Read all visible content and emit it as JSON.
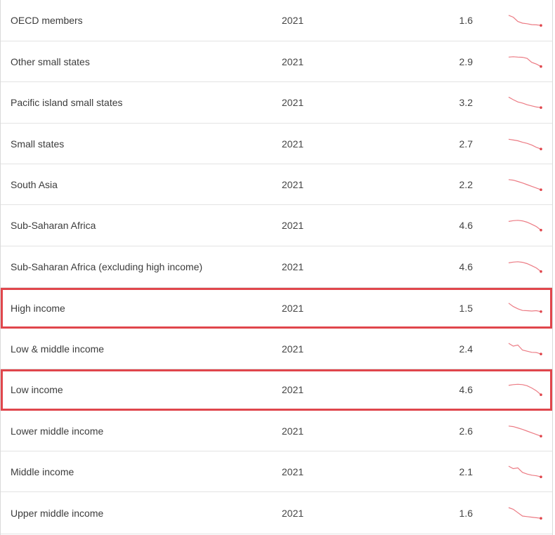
{
  "colors": {
    "sparkline": "#ec7b84",
    "highlight": "#e0464c"
  },
  "rows": [
    {
      "name": "OECD members",
      "year": "2021",
      "value": "1.6",
      "highlighted": false,
      "trend": [
        0.95,
        0.78,
        0.4,
        0.25,
        0.2,
        0.12,
        0.1,
        0.05
      ]
    },
    {
      "name": "Other small states",
      "year": "2021",
      "value": "2.9",
      "highlighted": false,
      "trend": [
        0.92,
        0.95,
        0.92,
        0.9,
        0.8,
        0.45,
        0.3,
        0.08
      ]
    },
    {
      "name": "Pacific island small states",
      "year": "2021",
      "value": "3.2",
      "highlighted": false,
      "trend": [
        0.98,
        0.75,
        0.55,
        0.45,
        0.3,
        0.2,
        0.1,
        0.05
      ]
    },
    {
      "name": "Small states",
      "year": "2021",
      "value": "2.7",
      "highlighted": false,
      "trend": [
        0.92,
        0.85,
        0.78,
        0.65,
        0.55,
        0.4,
        0.2,
        0.05
      ]
    },
    {
      "name": "South Asia",
      "year": "2021",
      "value": "2.2",
      "highlighted": false,
      "trend": [
        0.95,
        0.9,
        0.78,
        0.65,
        0.5,
        0.35,
        0.2,
        0.05
      ]
    },
    {
      "name": "Sub-Saharan Africa",
      "year": "2021",
      "value": "4.6",
      "highlighted": false,
      "trend": [
        0.85,
        0.92,
        0.95,
        0.9,
        0.78,
        0.6,
        0.4,
        0.08
      ]
    },
    {
      "name": "Sub-Saharan Africa (excluding high income)",
      "year": "2021",
      "value": "4.6",
      "highlighted": false,
      "trend": [
        0.85,
        0.92,
        0.95,
        0.9,
        0.78,
        0.6,
        0.4,
        0.08
      ]
    },
    {
      "name": "High income",
      "year": "2021",
      "value": "1.5",
      "highlighted": true,
      "trend": [
        0.95,
        0.65,
        0.45,
        0.3,
        0.28,
        0.25,
        0.28,
        0.2
      ]
    },
    {
      "name": "Low & middle income",
      "year": "2021",
      "value": "2.4",
      "highlighted": false,
      "trend": [
        1.0,
        0.75,
        0.85,
        0.4,
        0.3,
        0.2,
        0.18,
        0.05
      ]
    },
    {
      "name": "Low income",
      "year": "2021",
      "value": "4.6",
      "highlighted": true,
      "trend": [
        0.88,
        0.95,
        0.98,
        0.95,
        0.85,
        0.65,
        0.4,
        0.05
      ]
    },
    {
      "name": "Lower middle income",
      "year": "2021",
      "value": "2.6",
      "highlighted": false,
      "trend": [
        0.95,
        0.9,
        0.78,
        0.65,
        0.5,
        0.35,
        0.2,
        0.05
      ]
    },
    {
      "name": "Middle income",
      "year": "2021",
      "value": "2.1",
      "highlighted": false,
      "trend": [
        1.0,
        0.78,
        0.85,
        0.45,
        0.3,
        0.2,
        0.15,
        0.05
      ]
    },
    {
      "name": "Upper middle income",
      "year": "2021",
      "value": "1.6",
      "highlighted": false,
      "trend": [
        1.0,
        0.85,
        0.55,
        0.25,
        0.2,
        0.15,
        0.1,
        0.05
      ]
    }
  ]
}
